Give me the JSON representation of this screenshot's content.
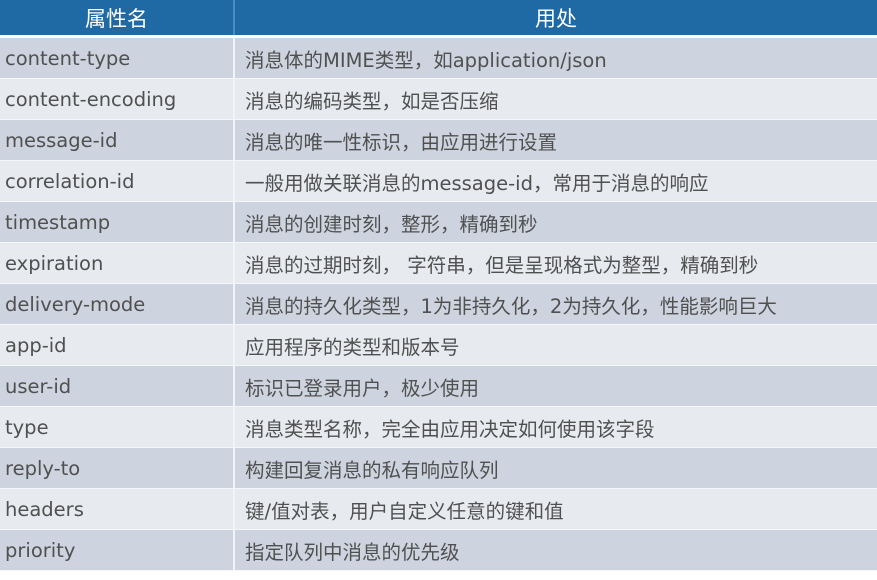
{
  "table": {
    "headers": {
      "name": "属性名",
      "usage": "用处"
    },
    "rows": [
      {
        "name": "content-type",
        "usage": "消息体的MIME类型，如application/json"
      },
      {
        "name": "content-encoding",
        "usage": "消息的编码类型，如是否压缩"
      },
      {
        "name": "message-id",
        "usage": "消息的唯一性标识，由应用进行设置"
      },
      {
        "name": "correlation-id",
        "usage": "一般用做关联消息的message-id，常用于消息的响应"
      },
      {
        "name": "timestamp",
        "usage": "消息的创建时刻，整形，精确到秒"
      },
      {
        "name": "expiration",
        "usage": "消息的过期时刻， 字符串，但是呈现格式为整型，精确到秒"
      },
      {
        "name": "delivery-mode",
        "usage": "消息的持久化类型，1为非持久化，2为持久化，性能影响巨大"
      },
      {
        "name": "app-id",
        "usage": "应用程序的类型和版本号"
      },
      {
        "name": "user-id",
        "usage": "标识已登录用户，极少使用"
      },
      {
        "name": "type",
        "usage": "消息类型名称，完全由应用决定如何使用该字段"
      },
      {
        "name": "reply-to",
        "usage": "构建回复消息的私有响应队列"
      },
      {
        "name": "headers",
        "usage": "键/值对表，用户自定义任意的键和值"
      },
      {
        "name": "priority",
        "usage": "指定队列中消息的优先级"
      }
    ]
  },
  "colors": {
    "header_bg": "#1f69a4",
    "row_dark": "#cdd4df",
    "row_light": "#e7eaef",
    "text": "#505050"
  }
}
